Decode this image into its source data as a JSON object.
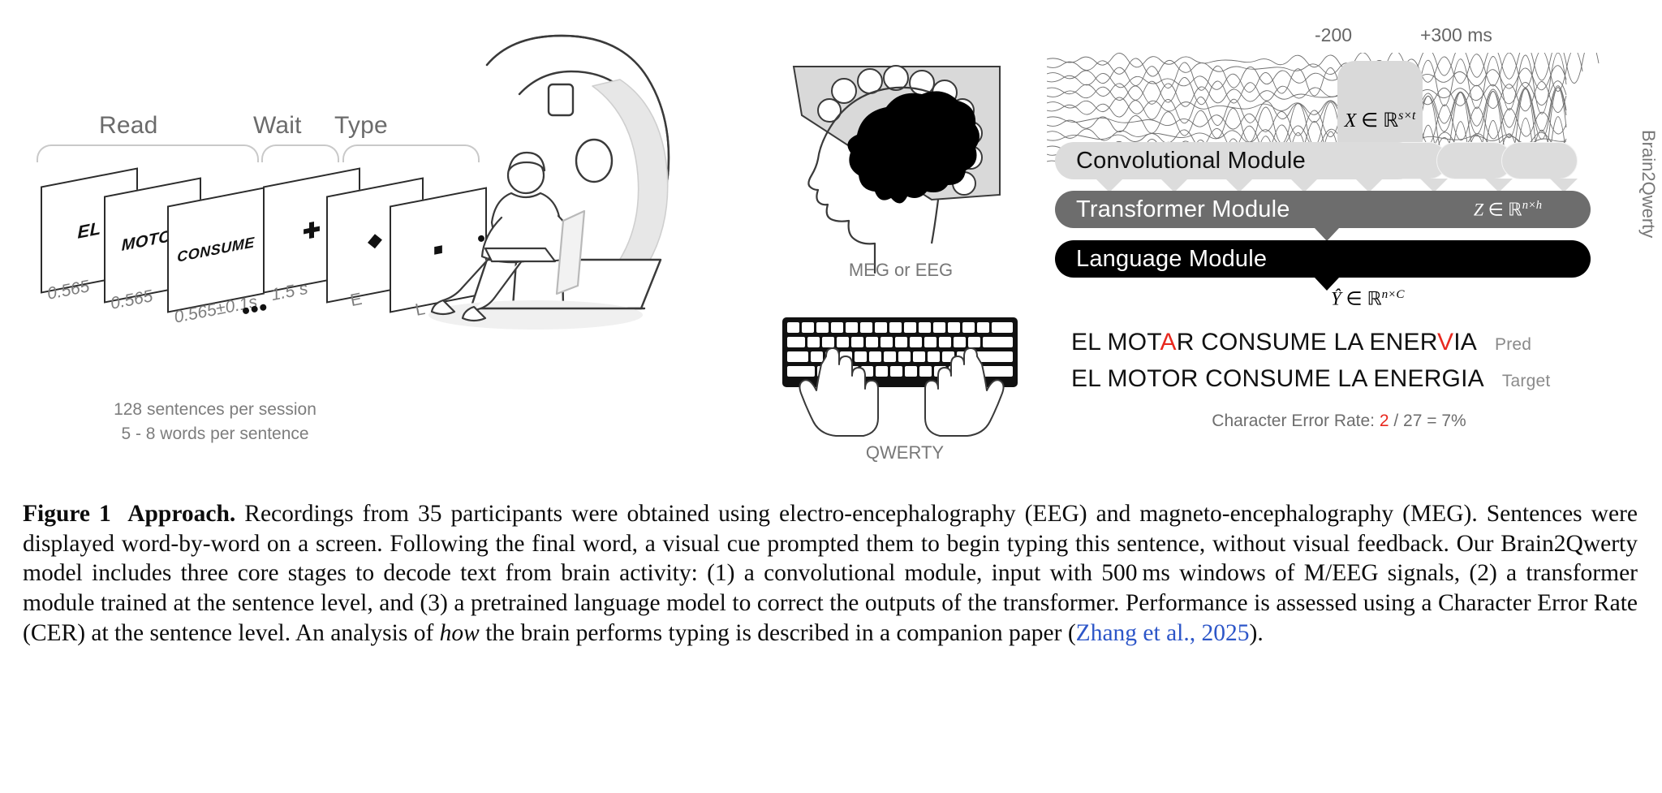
{
  "figure": {
    "protocol": {
      "phases": [
        {
          "label": "Read"
        },
        {
          "label": "Wait"
        },
        {
          "label": "Type"
        }
      ],
      "read_screens": [
        {
          "word": "EL",
          "duration": "0.565"
        },
        {
          "word": "MOTOR",
          "duration": "0.565"
        },
        {
          "word": "CONSUME",
          "duration": "0.565±0.1s"
        }
      ],
      "read_ellipsis": "•••",
      "wait_screen": {
        "symbol": "✚",
        "duration": "1.5 s"
      },
      "type_screens": [
        {
          "symbol": "◆",
          "label": "E"
        },
        {
          "symbol": "■",
          "label": "L"
        }
      ],
      "type_ellipsis": "•••",
      "notes_line1": "128 sentences per session",
      "notes_line2": "5 - 8 words per sentence"
    },
    "acquisition": {
      "head_caption": "MEG or EEG",
      "keyboard_caption": "QWERTY"
    },
    "model": {
      "time_start": "-200",
      "time_end": "+300 ms",
      "input_equation_var": "X",
      "input_equation_sup": "s×t",
      "modules": [
        {
          "name": "conv",
          "label": "Convolutional Module",
          "equation_var": "",
          "equation_sup": ""
        },
        {
          "name": "transformer",
          "label": "Transformer Module",
          "equation_var": "Z",
          "equation_sup": "n×h"
        },
        {
          "name": "language",
          "label": "Language Module",
          "equation_var": "",
          "equation_sup": ""
        }
      ],
      "output_equation_var": "Ŷ",
      "output_equation_sup": "n×C",
      "pipeline_label": "Brain2Qwerty",
      "prediction": {
        "prefix": "EL MOT",
        "error1": "A",
        "middle": "R CONSUME LA ENER",
        "error2": "V",
        "suffix": "IA",
        "tag": "Pred"
      },
      "target": {
        "text": "EL MOTOR CONSUME LA ENERGIA",
        "tag": "Target"
      },
      "cer": {
        "label": "Character Error Rate:",
        "errors": "2",
        "formula": "/ 27 = 7%"
      }
    },
    "colors": {
      "conv_module": "#dcdcdc",
      "transformer_module": "#6d6d6d",
      "language_module": "#000000",
      "error_red": "#e8281e",
      "citation_blue": "#2d56c8",
      "muted_gray": "#7d7d7d"
    }
  },
  "caption": {
    "figure_number": "Figure 1",
    "title": "Approach.",
    "body_1": " Recordings from 35 participants were obtained using electro-encephalography (EEG) and magneto-encephalography (MEG). Sentences were displayed word-by-word on a screen. Following the final word, a visual cue prompted them to begin typing this sentence, without visual feedback. Our Brain2Qwerty model includes three core stages to decode text from brain activity: (1) a convolutional module, input with 500 ms windows of M/EEG signals, (2) a transformer module trained at the sentence level, and (3) a pretrained language model to correct the outputs of the transformer. Performance is assessed using a Character Error Rate (CER) at the sentence level. An analysis of ",
    "italic_word": "how",
    "body_2": " the brain performs typing is described in a companion paper (",
    "citation": "Zhang et al., 2025",
    "body_3": ")."
  }
}
